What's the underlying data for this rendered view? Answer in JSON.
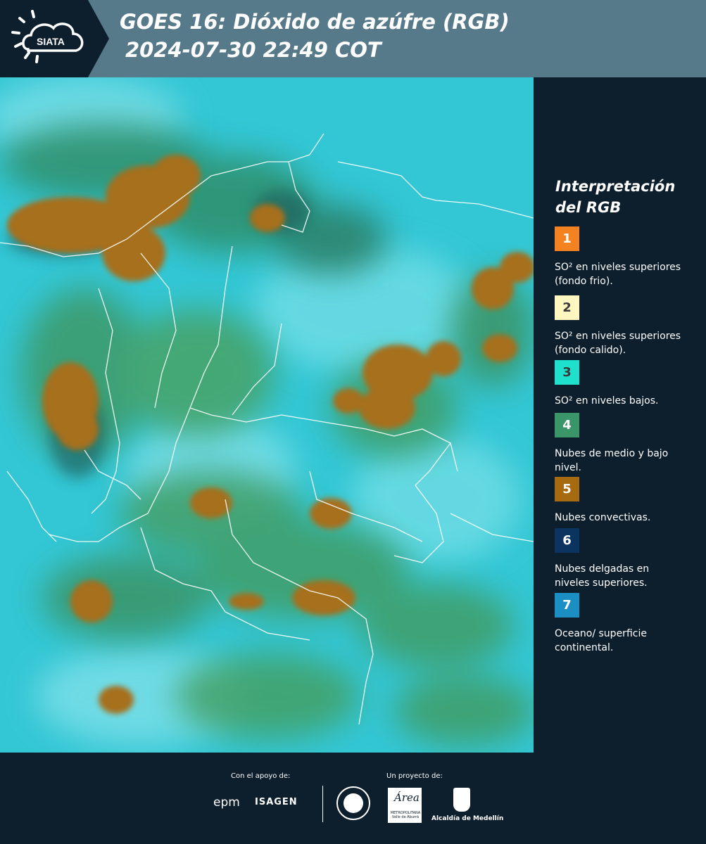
{
  "header": {
    "logo_text": "SIATA",
    "title_line1": "GOES 16: Dióxido de azúfre (RGB)",
    "title_line2": "2024-07-30 22:49 COT"
  },
  "legend": {
    "title": "Interpretación del RGB",
    "items": [
      {
        "number": "1",
        "label": "SO² en niveles superiores (fondo frio).",
        "color": "#f58220"
      },
      {
        "number": "2",
        "label": "SO² en niveles superiores (fondo calido).",
        "color": "#fff6c0"
      },
      {
        "number": "3",
        "label": "SO² en niveles bajos.",
        "color": "#1fe0cc"
      },
      {
        "number": "4",
        "label": "Nubes de medio y bajo nivel.",
        "color": "#3a9568"
      },
      {
        "number": "5",
        "label": "Nubes convectivas.",
        "color": "#a66a10"
      },
      {
        "number": "6",
        "label": "Nubes delgadas en niveles superiores.",
        "color": "#0c3461"
      },
      {
        "number": "7",
        "label": "Oceano/ superficie continental.",
        "color": "#1b8fc4"
      }
    ]
  },
  "footer": {
    "support_label": "Con el apoyo de:",
    "project_label": "Un proyecto de:",
    "sponsors": [
      "epm",
      "ISAGEN"
    ],
    "partners": [
      "Área Metropolitana Valle de Aburrá",
      "Alcaldía de Medellín"
    ],
    "epm_text": "epm",
    "isagen_text": "ISAGEN",
    "area_text": "Área",
    "area_subtext": "METROPOLITANA Valle de Aburrá",
    "alcaldia_text": "Alcaldía de Medellín"
  },
  "colors": {
    "header_bg": "#577a8a",
    "panel_bg": "#0d1e2c",
    "map_base": "#33c6d4"
  }
}
